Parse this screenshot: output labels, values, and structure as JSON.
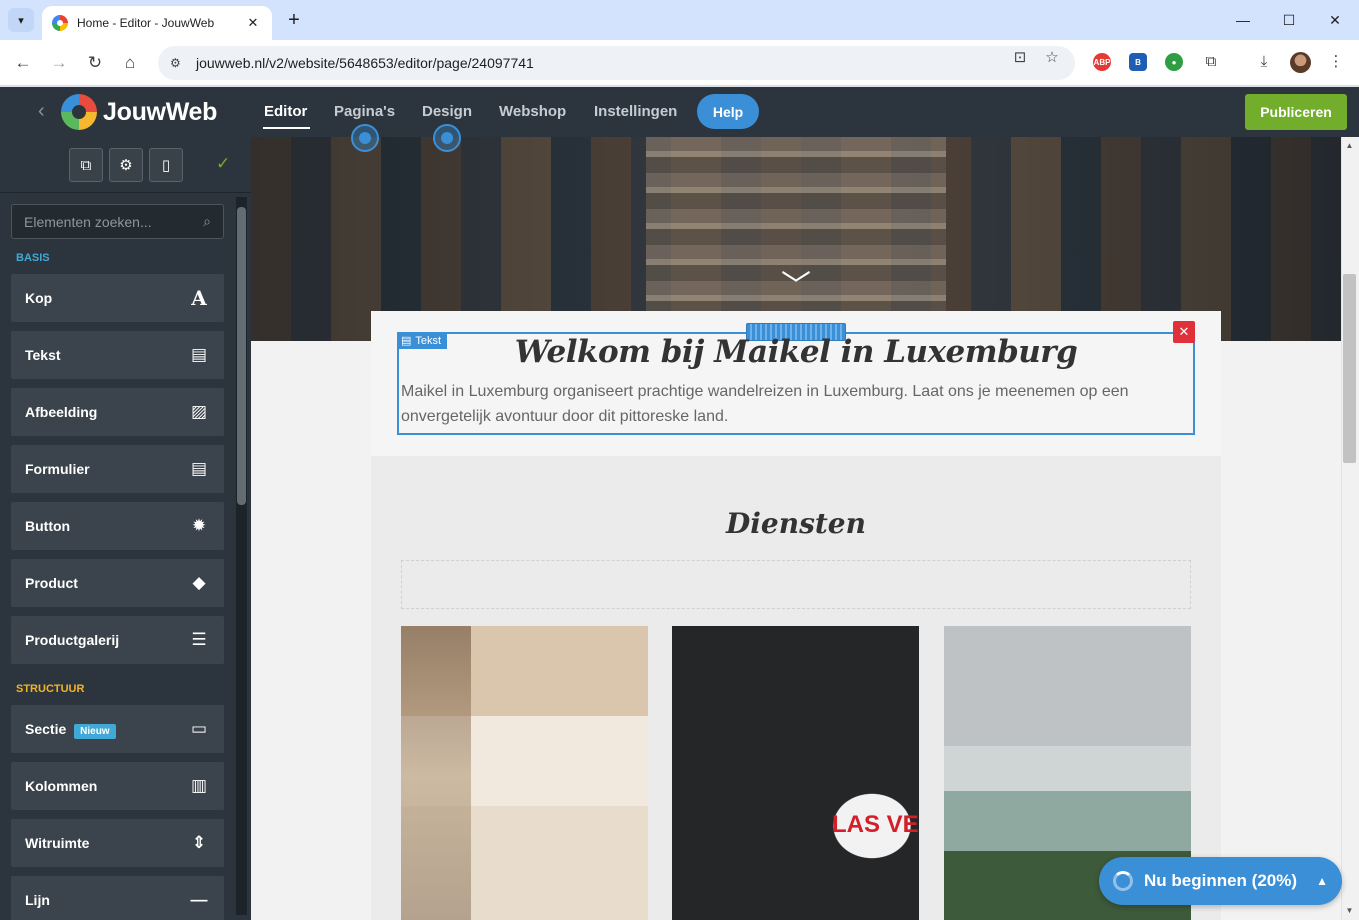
{
  "browser": {
    "tab_title": "Home - Editor - JouwWeb",
    "url": "jouwweb.nl/v2/website/5648653/editor/page/24097741"
  },
  "app": {
    "logo": "JouwWeb",
    "nav": {
      "editor": "Editor",
      "pages": "Pagina's",
      "design": "Design",
      "webshop": "Webshop",
      "settings": "Instellingen",
      "help": "Help"
    },
    "publish": "Publiceren"
  },
  "sidebar": {
    "search_placeholder": "Elementen zoeken...",
    "section_basis": "BASIS",
    "section_structure": "STRUCTUUR",
    "basis_items": [
      {
        "label": "Kop",
        "icon": "heading-icon"
      },
      {
        "label": "Tekst",
        "icon": "text-icon"
      },
      {
        "label": "Afbeelding",
        "icon": "image-icon"
      },
      {
        "label": "Formulier",
        "icon": "form-icon"
      },
      {
        "label": "Button",
        "icon": "button-icon"
      },
      {
        "label": "Product",
        "icon": "tag-icon"
      },
      {
        "label": "Productgalerij",
        "icon": "list-icon"
      }
    ],
    "structure_items": [
      {
        "label": "Sectie",
        "badge": "Nieuw",
        "icon": "section-icon"
      },
      {
        "label": "Kolommen",
        "icon": "columns-icon"
      },
      {
        "label": "Witruimte",
        "icon": "spacing-icon"
      },
      {
        "label": "Lijn",
        "icon": "line-icon"
      }
    ]
  },
  "canvas": {
    "text_tag": "Tekst",
    "welcome_title": "Welkom bij Maikel in Luxemburg",
    "intro": "Maikel in Luxemburg organiseert prachtige wandelreizen in Luxemburg. Laat ons je meenemen op een onvergetelijk avontuur door dit pittoreske land.",
    "services_title": "Diensten",
    "vegas_sign_text": "LAS VE"
  },
  "onboarding": {
    "label": "Nu beginnen (20%)",
    "progress_percent": 20
  },
  "colors": {
    "accent": "#3b8fd6",
    "publish": "#72ad2c",
    "header": "#2c353d",
    "close": "#e0303a",
    "section_basis": "#41a9d8",
    "section_structure": "#f0b429"
  }
}
